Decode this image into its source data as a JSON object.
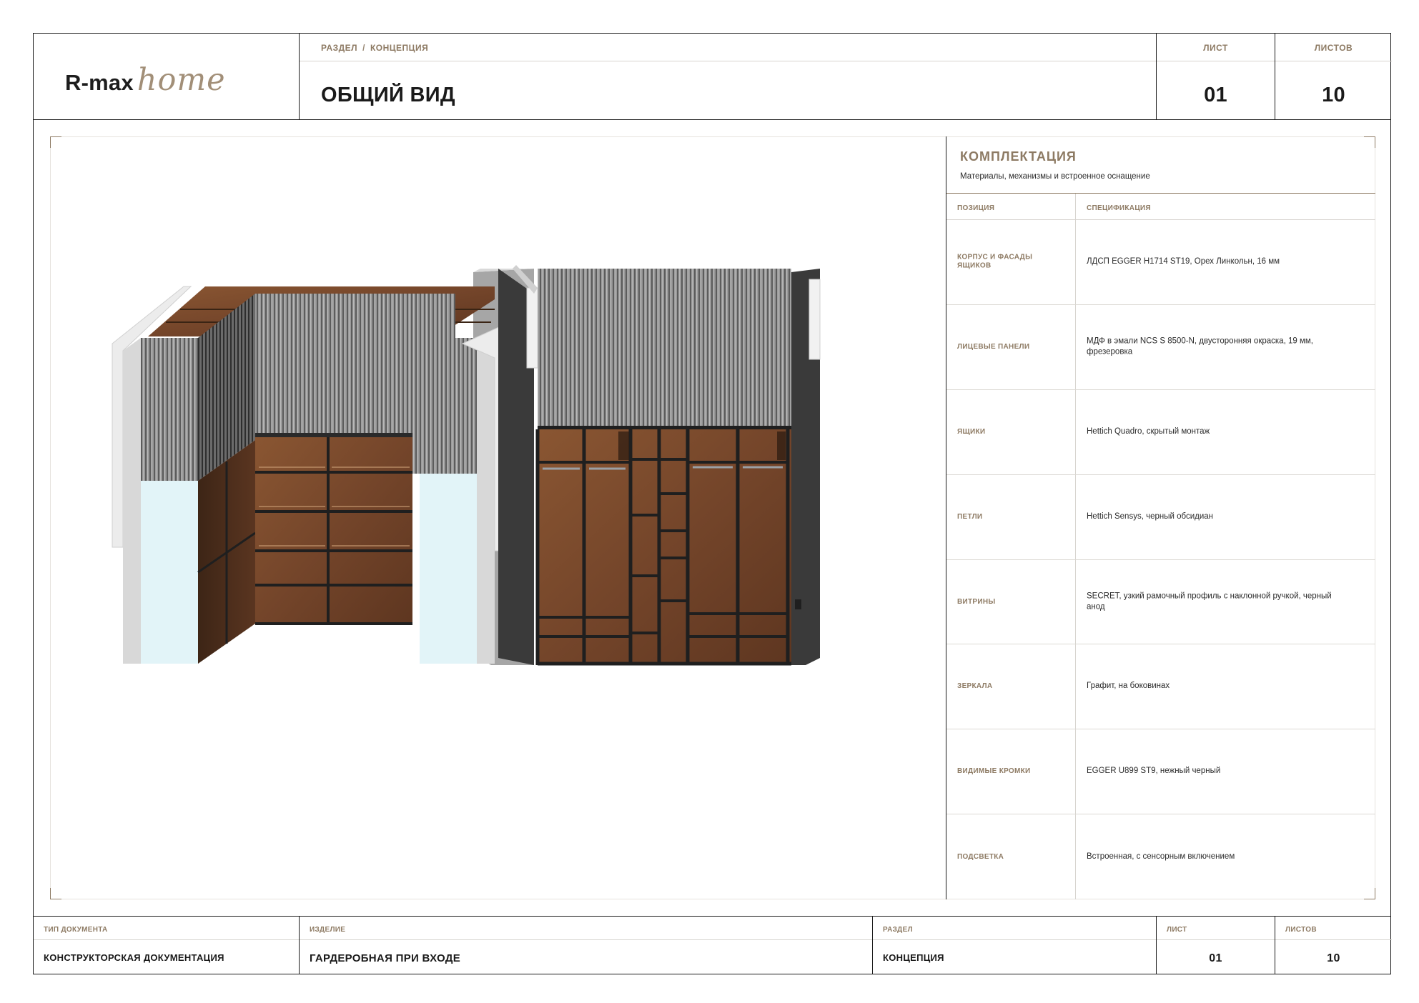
{
  "header": {
    "logo": {
      "brand": "R-max",
      "script": "home"
    },
    "breadcrumb": {
      "section": "РАЗДЕЛ",
      "separator": "/",
      "page": "КОНЦЕПЦИЯ"
    },
    "title": "ОБЩИЙ ВИД",
    "sheet": {
      "label": "ЛИСТ",
      "value": "01"
    },
    "sheets": {
      "label": "ЛИСТОВ",
      "value": "10"
    }
  },
  "spec": {
    "title": "КОМПЛЕКТАЦИЯ",
    "subtitle": "Материалы, механизмы и встроенное оснащение",
    "col_position": "ПОЗИЦИЯ",
    "col_spec": "СПЕЦИФИКАЦИЯ",
    "rows": [
      {
        "position": "КОРПУС И ФАСАДЫ ЯЩИКОВ",
        "spec": "ЛДСП EGGER H1714 ST19, Орех Линкольн, 16 мм"
      },
      {
        "position": "ЛИЦЕВЫЕ ПАНЕЛИ",
        "spec": "МДФ в эмали NCS S 8500-N, двусторонняя окраска, 19 мм, фрезеровка"
      },
      {
        "position": "ЯЩИКИ",
        "spec": "Hettich Quadro, скрытый монтаж"
      },
      {
        "position": "ПЕТЛИ",
        "spec": "Hettich Sensys, черный обсидиан"
      },
      {
        "position": "ВИТРИНЫ",
        "spec": "SECRET, узкий рамочный профиль с наклонной ручкой, черный анод"
      },
      {
        "position": "ЗЕРКАЛА",
        "spec": "Графит, на боковинах"
      },
      {
        "position": "ВИДИМЫЕ КРОМКИ",
        "spec": "EGGER U899 ST9, нежный черный"
      },
      {
        "position": "ПОДСВЕТКА",
        "spec": "Встроенная, с сенсорным включением"
      }
    ]
  },
  "footer": {
    "doc_type": {
      "label": "ТИП ДОКУМЕНТА",
      "value": "КОНСТРУКТОРСКАЯ ДОКУМЕНТАЦИЯ"
    },
    "product": {
      "label": "ИЗДЕЛИЕ",
      "value": "ГАРДЕРОБНАЯ ПРИ ВХОДЕ"
    },
    "section": {
      "label": "РАЗДЕЛ",
      "value": "КОНЦЕПЦИЯ"
    },
    "sheet": {
      "label": "ЛИСТ",
      "value": "01"
    },
    "sheets": {
      "label": "ЛИСТОВ",
      "value": "10"
    }
  },
  "colors": {
    "accent": "#8d7a63",
    "ink": "#1a1a1a",
    "walnut": "#7a4a2a",
    "panel_grey": "#8a8a8a",
    "mirror": "#e2f4f8"
  }
}
